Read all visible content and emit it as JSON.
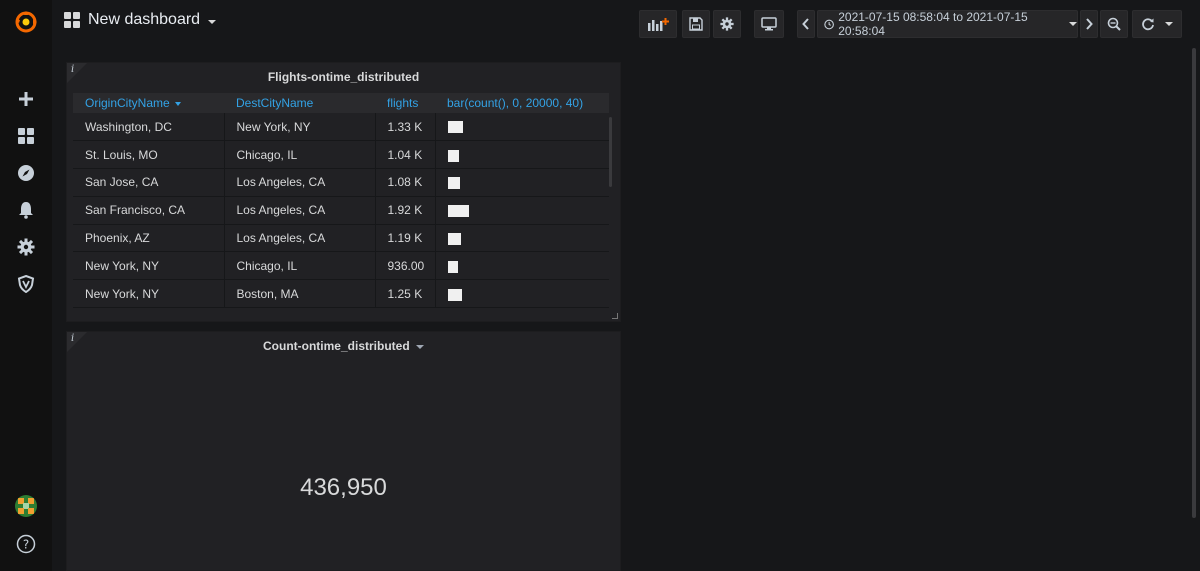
{
  "header": {
    "title": "New dashboard",
    "time_range": "2021-07-15 08:58:04 to 2021-07-15 20:58:04"
  },
  "sidebar": {
    "icons": [
      "grafana-logo",
      "plus-icon",
      "dashboards-icon",
      "explore-icon",
      "alert-bell-icon",
      "gear-icon",
      "shield-icon",
      "avatar",
      "help-icon"
    ]
  },
  "table_panel": {
    "title": "Flights-ontime_distributed",
    "columns": [
      "OriginCityName",
      "DestCityName",
      "flights",
      "bar(count(), 0, 20000, 40)"
    ],
    "rows": [
      {
        "origin": "Washington, DC",
        "dest": "New York, NY",
        "flights": "1.33 K",
        "bar_fraction": 0.0665
      },
      {
        "origin": "St. Louis, MO",
        "dest": "Chicago, IL",
        "flights": "1.04 K",
        "bar_fraction": 0.052
      },
      {
        "origin": "San Jose, CA",
        "dest": "Los Angeles, CA",
        "flights": "1.08 K",
        "bar_fraction": 0.054
      },
      {
        "origin": "San Francisco, CA",
        "dest": "Los Angeles, CA",
        "flights": "1.92 K",
        "bar_fraction": 0.096
      },
      {
        "origin": "Phoenix, AZ",
        "dest": "Los Angeles, CA",
        "flights": "1.19 K",
        "bar_fraction": 0.0595
      },
      {
        "origin": "New York, NY",
        "dest": "Chicago, IL",
        "flights": "936.00",
        "bar_fraction": 0.0468
      },
      {
        "origin": "New York, NY",
        "dest": "Boston, MA",
        "flights": "1.25 K",
        "bar_fraction": 0.0625
      }
    ]
  },
  "stat_panel": {
    "title": "Count-ontime_distributed",
    "value": "436,950"
  },
  "colors": {
    "background": "#161719",
    "panel": "#212124",
    "accent_blue": "#33a2e5",
    "logo_orange": "#f46800"
  }
}
